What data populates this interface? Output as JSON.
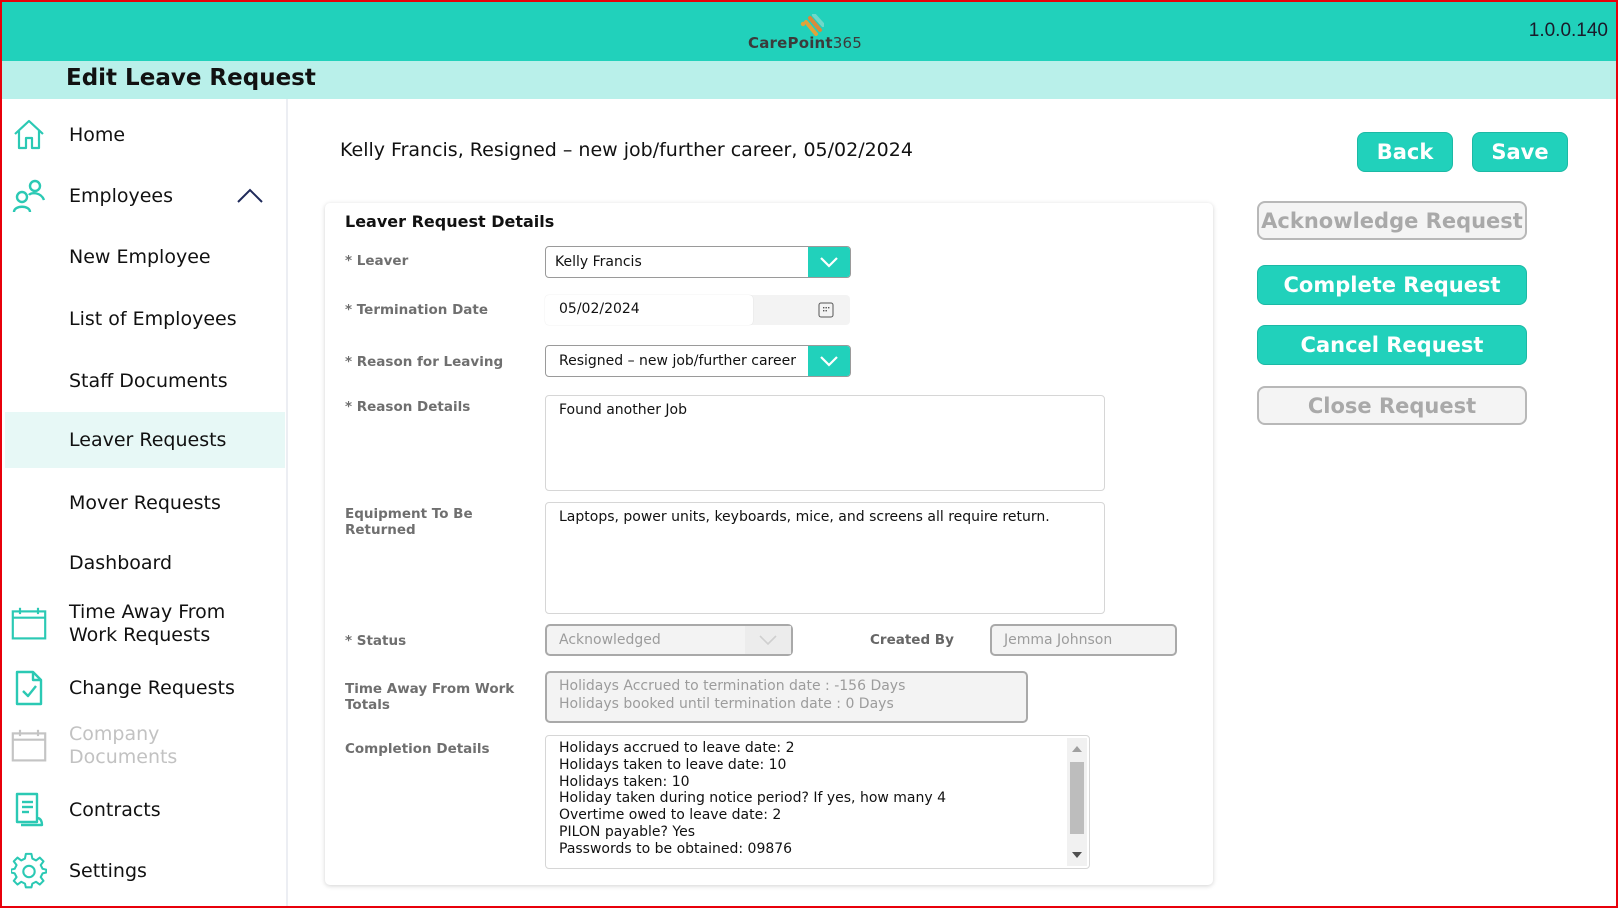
{
  "app": {
    "brand_name": "CarePoint",
    "brand_suffix": "365",
    "version": "1.0.0.140",
    "accent_color": "#21d1bb",
    "subheader_color": "#b9f0ea"
  },
  "page": {
    "title": "Edit Leave Request",
    "request_heading": "Kelly Francis, Resigned – new job/further career, 05/02/2024"
  },
  "sidebar": {
    "items": [
      {
        "label": "Home",
        "icon": "home-icon"
      },
      {
        "label": "Employees",
        "icon": "users-icon",
        "expanded": true
      },
      {
        "label": "New Employee"
      },
      {
        "label": "List of Employees"
      },
      {
        "label": "Staff Documents"
      },
      {
        "label": "Leaver Requests",
        "active": true
      },
      {
        "label": "Mover Requests"
      },
      {
        "label": "Dashboard"
      },
      {
        "label": "Time Away From Work Requests",
        "icon": "calendar-icon"
      },
      {
        "label": "Change Requests",
        "icon": "document-check-icon"
      },
      {
        "label": "Company Documents",
        "icon": "calendar-icon",
        "disabled": true
      },
      {
        "label": "Contracts",
        "icon": "contract-icon"
      },
      {
        "label": "Settings",
        "icon": "gear-icon"
      }
    ]
  },
  "toolbar": {
    "back_label": "Back",
    "save_label": "Save"
  },
  "actions": {
    "acknowledge_label": "Acknowledge Request",
    "acknowledge_enabled": false,
    "complete_label": "Complete Request",
    "complete_enabled": true,
    "cancel_label": "Cancel Request",
    "cancel_enabled": true,
    "close_label": "Close Request",
    "close_enabled": false
  },
  "form": {
    "section_title": "Leaver Request Details",
    "leaver": {
      "label": "* Leaver",
      "value": "Kelly Francis"
    },
    "termination_date": {
      "label": "* Termination Date",
      "value": "05/02/2024"
    },
    "reason_for_leaving": {
      "label": "* Reason for Leaving",
      "value": "Resigned – new job/further career"
    },
    "reason_details": {
      "label": "* Reason Details",
      "value": "Found another Job"
    },
    "equipment": {
      "label": "Equipment To Be Returned",
      "value": "Laptops, power units, keyboards, mice, and screens all require return."
    },
    "status": {
      "label": "* Status",
      "value": "Acknowledged"
    },
    "created_by": {
      "label": "Created By",
      "value": "Jemma Johnson"
    },
    "time_away_totals": {
      "label": "Time Away From Work Totals",
      "lines": [
        "Holidays Accrued to termination date : -156 Days",
        "Holidays booked until termination date : 0 Days"
      ]
    },
    "completion_details": {
      "label": "Completion Details",
      "lines": [
        "Holidays accrued to leave date: 2",
        "Holidays taken to leave date: 10",
        "Holidays taken: 10",
        "Holiday taken during notice period? If yes, how many 4",
        "Overtime owed to leave date: 2",
        "PILON payable? Yes",
        "Passwords to be obtained: 09876"
      ]
    }
  }
}
